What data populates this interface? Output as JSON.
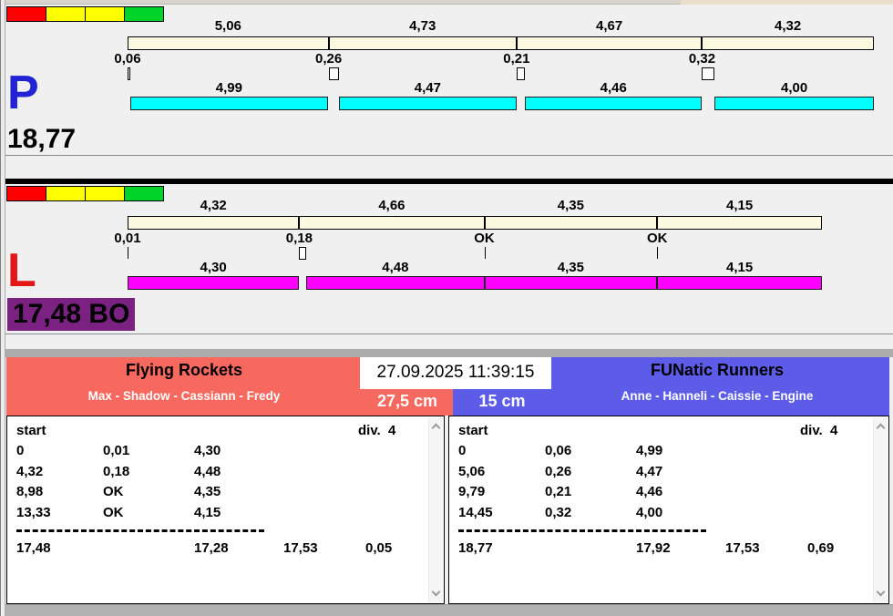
{
  "colors": {
    "indicator": [
      "#FF0000",
      "#FFFF00",
      "#FFFF00",
      "#00D42A"
    ],
    "lane_p_bar": "#00FFFF",
    "lane_l_bar": "#FF00FF",
    "split_bar": "#FBF9E0",
    "lane_p_letter": "#2222D6",
    "lane_l_letter": "#E31717",
    "lane_l_total_bg": "#7B2182",
    "team_left_bg": "#F7685E",
    "team_right_bg": "#5C5CE8"
  },
  "lanes": {
    "p": {
      "letter": "P",
      "total": "18,77",
      "splits": [
        {
          "label": "5,06",
          "value": 5.06
        },
        {
          "label": "4,73",
          "value": 4.73
        },
        {
          "label": "4,67",
          "value": 4.67
        },
        {
          "label": "4,32",
          "value": 4.32
        }
      ],
      "exchanges": [
        {
          "label": "0,06",
          "value": 0.06
        },
        {
          "label": "0,26",
          "value": 0.26
        },
        {
          "label": "0,21",
          "value": 0.21
        },
        {
          "label": "0,32",
          "value": 0.32
        }
      ],
      "legs": [
        {
          "label": "4,99",
          "value": 4.99
        },
        {
          "label": "4,47",
          "value": 4.47
        },
        {
          "label": "4,46",
          "value": 4.46
        },
        {
          "label": "4,00",
          "value": 4.0
        }
      ]
    },
    "l": {
      "letter": "L",
      "total": "17,48 BO",
      "splits": [
        {
          "label": "4,32",
          "value": 4.32
        },
        {
          "label": "4,66",
          "value": 4.66
        },
        {
          "label": "4,35",
          "value": 4.35
        },
        {
          "label": "4,15",
          "value": 4.15
        }
      ],
      "exchanges": [
        {
          "label": "0,01",
          "value": 0.01
        },
        {
          "label": "0,18",
          "value": 0.18
        },
        {
          "label": "OK",
          "value": 0
        },
        {
          "label": "OK",
          "value": 0
        }
      ],
      "legs": [
        {
          "label": "4,30",
          "value": 4.3
        },
        {
          "label": "4,48",
          "value": 4.48
        },
        {
          "label": "4,35",
          "value": 4.35
        },
        {
          "label": "4,15",
          "value": 4.15
        }
      ]
    }
  },
  "datetime": "27.09.2025 11:39:15",
  "teams": {
    "left": {
      "name": "Flying Rockets",
      "members": "Max - Shadow - Cassiann - Fredy",
      "cm": "27,5 cm",
      "table": {
        "start_label": "start",
        "div_label": "div.  4",
        "rows": [
          [
            "0",
            "0,01",
            "4,30"
          ],
          [
            "4,32",
            "0,18",
            "4,48"
          ],
          [
            "8,98",
            "OK",
            "4,35"
          ],
          [
            "13,33",
            "OK",
            "4,15"
          ]
        ],
        "totals": [
          "17,48",
          "17,28",
          "17,53",
          "0,05"
        ]
      }
    },
    "right": {
      "name": "FUNatic Runners",
      "members": "Anne - Hanneli - Caissie - Engine",
      "cm": "15 cm",
      "table": {
        "start_label": "start",
        "div_label": "div.  4",
        "rows": [
          [
            "0",
            "0,06",
            "4,99"
          ],
          [
            "5,06",
            "0,26",
            "4,47"
          ],
          [
            "9,79",
            "0,21",
            "4,46"
          ],
          [
            "14,45",
            "0,32",
            "4,00"
          ]
        ],
        "totals": [
          "18,77",
          "17,92",
          "17,53",
          "0,69"
        ]
      }
    }
  }
}
